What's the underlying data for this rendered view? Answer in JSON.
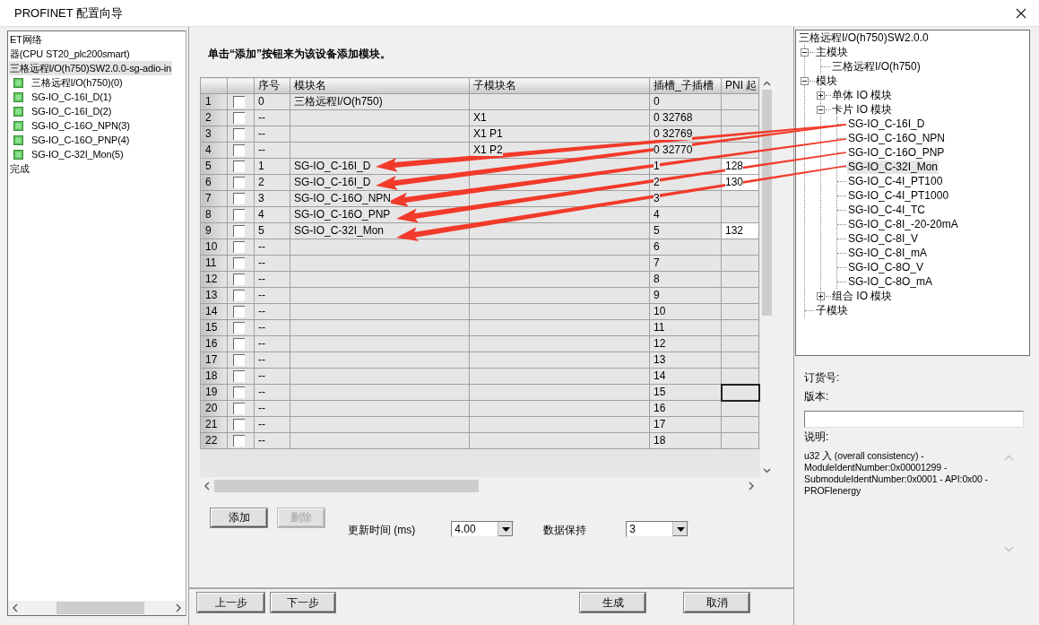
{
  "window": {
    "title": "PROFINET 配置向导"
  },
  "left_tree": {
    "items": [
      {
        "label": "ET网络",
        "selected": false
      },
      {
        "label": "器(CPU ST20_plc200smart)",
        "selected": false
      },
      {
        "label": "三格远程I/O(h750)SW2.0.0-sg-adio-in",
        "selected": true,
        "children": [
          {
            "label": "三格远程I/O(h750)(0)",
            "selected": false
          },
          {
            "label": "SG-IO_C-16I_D(1)",
            "selected": false
          },
          {
            "label": "SG-IO_C-16I_D(2)",
            "selected": false
          },
          {
            "label": "SG-IO_C-16O_NPN(3)",
            "selected": false
          },
          {
            "label": "SG-IO_C-16O_PNP(4)",
            "selected": false
          },
          {
            "label": "SG-IO_C-32I_Mon(5)",
            "selected": false
          }
        ]
      },
      {
        "label": "完成",
        "selected": false
      }
    ]
  },
  "wizard": {
    "instruction": "单击“添加”按钮来为该设备添加模块。",
    "table": {
      "columns": [
        "序号",
        "模块名",
        "子模块名",
        "插槽_子插槽",
        "PNI 起"
      ],
      "rows": [
        {
          "row": "1",
          "checked": false,
          "seq": "0",
          "module": "三格远程I/O(h750)",
          "slot": "0",
          "pni_editable": false,
          "pni_focused": false
        },
        {
          "row": "2",
          "checked": false,
          "seq": "--",
          "submodule": "X1",
          "slot": "0 32768",
          "pni_editable": false,
          "pni_focused": false
        },
        {
          "row": "3",
          "checked": false,
          "seq": "--",
          "submodule": "X1 P1",
          "slot": "0 32769",
          "pni_editable": false,
          "pni_focused": false
        },
        {
          "row": "4",
          "checked": false,
          "seq": "--",
          "submodule": "X1 P2",
          "slot": "0 32770",
          "pni_editable": false,
          "pni_focused": false
        },
        {
          "row": "5",
          "checked": false,
          "seq": "1",
          "module": "SG-IO_C-16I_D",
          "slot": "1",
          "pni": "128",
          "pni_editable": true,
          "pni_focused": false
        },
        {
          "row": "6",
          "checked": false,
          "seq": "2",
          "module": "SG-IO_C-16I_D",
          "slot": "2",
          "pni": "130",
          "pni_editable": true,
          "pni_focused": false
        },
        {
          "row": "7",
          "checked": false,
          "seq": "3",
          "module": "SG-IO_C-16O_NPN",
          "slot": "3",
          "pni_editable": false,
          "pni_focused": false
        },
        {
          "row": "8",
          "checked": false,
          "seq": "4",
          "module": "SG-IO_C-16O_PNP",
          "slot": "4",
          "pni_editable": false,
          "pni_focused": false
        },
        {
          "row": "9",
          "checked": false,
          "seq": "5",
          "module": "SG-IO_C-32I_Mon",
          "slot": "5",
          "pni": "132",
          "pni_editable": true,
          "pni_focused": false
        },
        {
          "row": "10",
          "checked": false,
          "seq": "--",
          "slot": "6",
          "pni_editable": false,
          "pni_focused": false
        },
        {
          "row": "11",
          "checked": false,
          "seq": "--",
          "slot": "7",
          "pni_editable": false,
          "pni_focused": false
        },
        {
          "row": "12",
          "checked": false,
          "seq": "--",
          "slot": "8",
          "pni_editable": false,
          "pni_focused": false
        },
        {
          "row": "13",
          "checked": false,
          "seq": "--",
          "slot": "9",
          "pni_editable": false,
          "pni_focused": false
        },
        {
          "row": "14",
          "checked": false,
          "seq": "--",
          "slot": "10",
          "pni_editable": false,
          "pni_focused": false
        },
        {
          "row": "15",
          "checked": false,
          "seq": "--",
          "slot": "11",
          "pni_editable": false,
          "pni_focused": false
        },
        {
          "row": "16",
          "checked": false,
          "seq": "--",
          "slot": "12",
          "pni_editable": false,
          "pni_focused": false
        },
        {
          "row": "17",
          "checked": false,
          "seq": "--",
          "slot": "13",
          "pni_editable": false,
          "pni_focused": false
        },
        {
          "row": "18",
          "checked": false,
          "seq": "--",
          "slot": "14",
          "pni_editable": false,
          "pni_focused": false
        },
        {
          "row": "19",
          "checked": false,
          "seq": "--",
          "slot": "15",
          "pni_editable": false,
          "pni_focused": true
        },
        {
          "row": "20",
          "checked": false,
          "seq": "--",
          "slot": "16",
          "pni_editable": false,
          "pni_focused": false
        },
        {
          "row": "21",
          "checked": false,
          "seq": "--",
          "slot": "17",
          "pni_editable": false,
          "pni_focused": false
        },
        {
          "row": "22",
          "checked": false,
          "seq": "--",
          "slot": "18",
          "pni_editable": false,
          "pni_focused": false
        }
      ]
    },
    "add_button": {
      "label": "添加",
      "disabled": false
    },
    "delete_button": {
      "label": "删除",
      "disabled": true
    },
    "update_time": {
      "label": "更新时间 (ms)",
      "value": "4.00"
    },
    "data_hold": {
      "label": "数据保持",
      "value": "3"
    },
    "back_button": "上一步",
    "next_button": "下一步",
    "generate_button": "生成",
    "cancel_button": "取消"
  },
  "catalog": {
    "title": "三格远程I/O(h750)SW2.0.0",
    "items": [
      {
        "label": "主模块",
        "kind": "folder",
        "expanded": true,
        "selected": false,
        "children": [
          {
            "label": "三格远程I/O(h750)",
            "kind": "leaf",
            "selected": false
          }
        ]
      },
      {
        "label": "模块",
        "kind": "folder",
        "expanded": true,
        "selected": false,
        "children": [
          {
            "label": "单体 IO 模块",
            "kind": "folder",
            "expanded": false,
            "selected": false
          },
          {
            "label": "卡片 IO 模块",
            "kind": "folder",
            "expanded": true,
            "selected": false,
            "children": [
              {
                "label": "SG-IO_C-16I_D",
                "kind": "leaf",
                "selected": false
              },
              {
                "label": "SG-IO_C-16O_NPN",
                "kind": "leaf",
                "selected": false
              },
              {
                "label": "SG-IO_C-16O_PNP",
                "kind": "leaf",
                "selected": false
              },
              {
                "label": "SG-IO_C-32I_Mon",
                "kind": "leaf",
                "selected": true
              },
              {
                "label": "SG-IO_C-4I_PT100",
                "kind": "leaf",
                "selected": false
              },
              {
                "label": "SG-IO_C-4I_PT1000",
                "kind": "leaf",
                "selected": false
              },
              {
                "label": "SG-IO_C-4I_TC",
                "kind": "leaf",
                "selected": false
              },
              {
                "label": "SG-IO_C-8I_-20-20mA",
                "kind": "leaf",
                "selected": false
              },
              {
                "label": "SG-IO_C-8I_V",
                "kind": "leaf",
                "selected": false
              },
              {
                "label": "SG-IO_C-8I_mA",
                "kind": "leaf",
                "selected": false
              },
              {
                "label": "SG-IO_C-8O_V",
                "kind": "leaf",
                "selected": false
              },
              {
                "label": "SG-IO_C-8O_mA",
                "kind": "leaf",
                "selected": false
              }
            ]
          },
          {
            "label": "组合 IO 模块",
            "kind": "folder",
            "expanded": false,
            "selected": false
          }
        ]
      },
      {
        "label": "子模块",
        "kind": "leaf",
        "selected": false
      }
    ]
  },
  "info": {
    "order_label": "订货号:",
    "version_label": "版本:",
    "description_label": "说明:",
    "description": "u32 入 (overall consistency) - ModuleIdentNumber:0x00001299 - SubmoduleIdentNumber:0x0001 - API:0x00 - PROFIenergy"
  }
}
